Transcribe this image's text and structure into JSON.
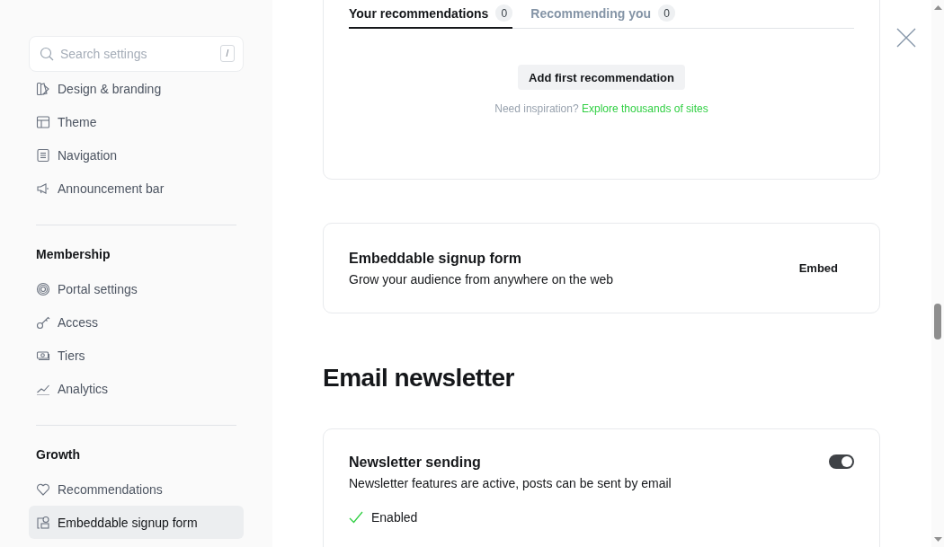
{
  "sidebar": {
    "search": {
      "placeholder": "Search settings",
      "shortcut": "/"
    },
    "groups": [
      {
        "items": [
          {
            "label": "Design & branding",
            "selected": false
          },
          {
            "label": "Theme",
            "selected": false
          },
          {
            "label": "Navigation",
            "selected": false
          },
          {
            "label": "Announcement bar",
            "selected": false
          }
        ]
      },
      {
        "heading": "Membership",
        "items": [
          {
            "label": "Portal settings",
            "selected": false
          },
          {
            "label": "Access",
            "selected": false
          },
          {
            "label": "Tiers",
            "selected": false
          },
          {
            "label": "Analytics",
            "selected": false
          }
        ]
      },
      {
        "heading": "Growth",
        "items": [
          {
            "label": "Recommendations",
            "selected": false
          },
          {
            "label": "Embeddable signup form",
            "selected": true
          }
        ]
      }
    ]
  },
  "recommendations": {
    "tabs": [
      {
        "label": "Your recommendations",
        "count": "0",
        "selected": true
      },
      {
        "label": "Recommending you",
        "count": "0",
        "selected": false
      }
    ],
    "button": "Add first recommendation",
    "hint": "Need inspiration?",
    "link": "Explore thousands of sites"
  },
  "signup_form": {
    "title": "Embeddable signup form",
    "description": "Grow your audience from anywhere on the web",
    "action": "Embed"
  },
  "section_title": "Email newsletter",
  "newsletter": {
    "title": "Newsletter sending",
    "description": "Newsletter features are active, posts can be sent by email",
    "on": true,
    "status": "Enabled"
  }
}
